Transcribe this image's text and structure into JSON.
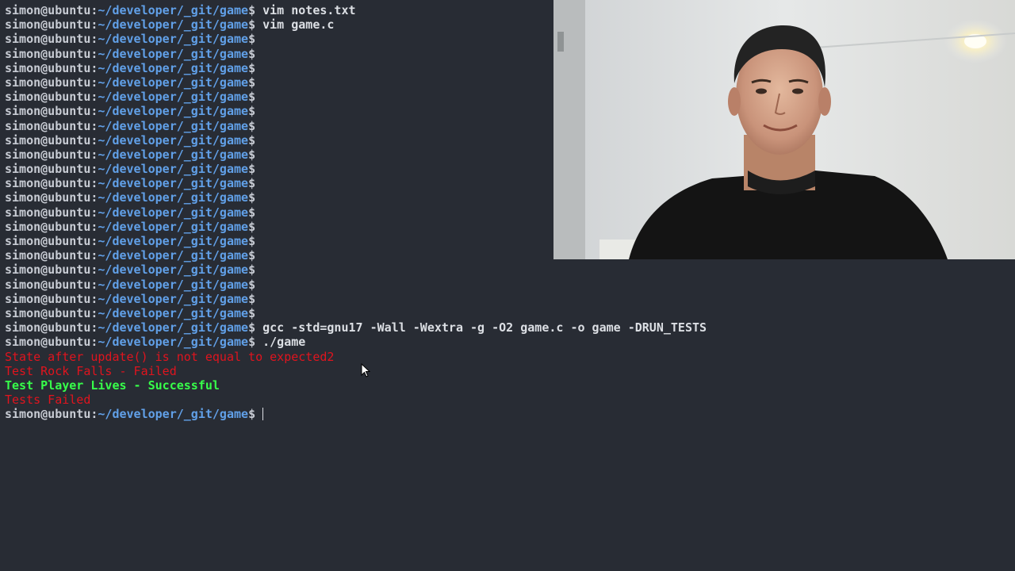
{
  "terminal": {
    "prompt_user": "simon@ubuntu",
    "prompt_sep": ":",
    "prompt_path": "~/developer/_git/game",
    "prompt_symbol": "$",
    "lines": [
      {
        "type": "prompt",
        "command": " vim notes.txt"
      },
      {
        "type": "prompt",
        "command": " vim game.c"
      },
      {
        "type": "prompt",
        "command": ""
      },
      {
        "type": "prompt",
        "command": ""
      },
      {
        "type": "prompt",
        "command": ""
      },
      {
        "type": "prompt",
        "command": ""
      },
      {
        "type": "prompt",
        "command": ""
      },
      {
        "type": "prompt",
        "command": ""
      },
      {
        "type": "prompt",
        "command": ""
      },
      {
        "type": "prompt",
        "command": ""
      },
      {
        "type": "prompt",
        "command": ""
      },
      {
        "type": "prompt",
        "command": ""
      },
      {
        "type": "prompt",
        "command": ""
      },
      {
        "type": "prompt",
        "command": ""
      },
      {
        "type": "prompt",
        "command": ""
      },
      {
        "type": "prompt",
        "command": ""
      },
      {
        "type": "prompt",
        "command": ""
      },
      {
        "type": "prompt",
        "command": ""
      },
      {
        "type": "prompt",
        "command": ""
      },
      {
        "type": "prompt",
        "command": ""
      },
      {
        "type": "prompt",
        "command": ""
      },
      {
        "type": "prompt",
        "command": ""
      },
      {
        "type": "prompt",
        "command": " gcc -std=gnu17 -Wall -Wextra -g -O2 game.c -o game -DRUN_TESTS"
      },
      {
        "type": "prompt",
        "command": " ./game"
      },
      {
        "type": "output",
        "style": "red",
        "text": "State after update() is not equal to expected2"
      },
      {
        "type": "output",
        "style": "red",
        "text": "Test Rock Falls - Failed"
      },
      {
        "type": "output",
        "style": "green",
        "text": "Test Player Lives - Successful"
      },
      {
        "type": "output",
        "style": "red",
        "text": "Tests Failed"
      },
      {
        "type": "prompt",
        "command": " ",
        "cursor": true
      }
    ]
  },
  "colors": {
    "background": "#282c34",
    "prompt_user": "#c8ccd4",
    "prompt_path": "#61a0e8",
    "error_text": "#e0141e",
    "success_text": "#37ff4a"
  },
  "overlay": {
    "webcam_icon": "presenter-webcam-feed",
    "pointer_icon": "mouse-pointer-icon"
  }
}
